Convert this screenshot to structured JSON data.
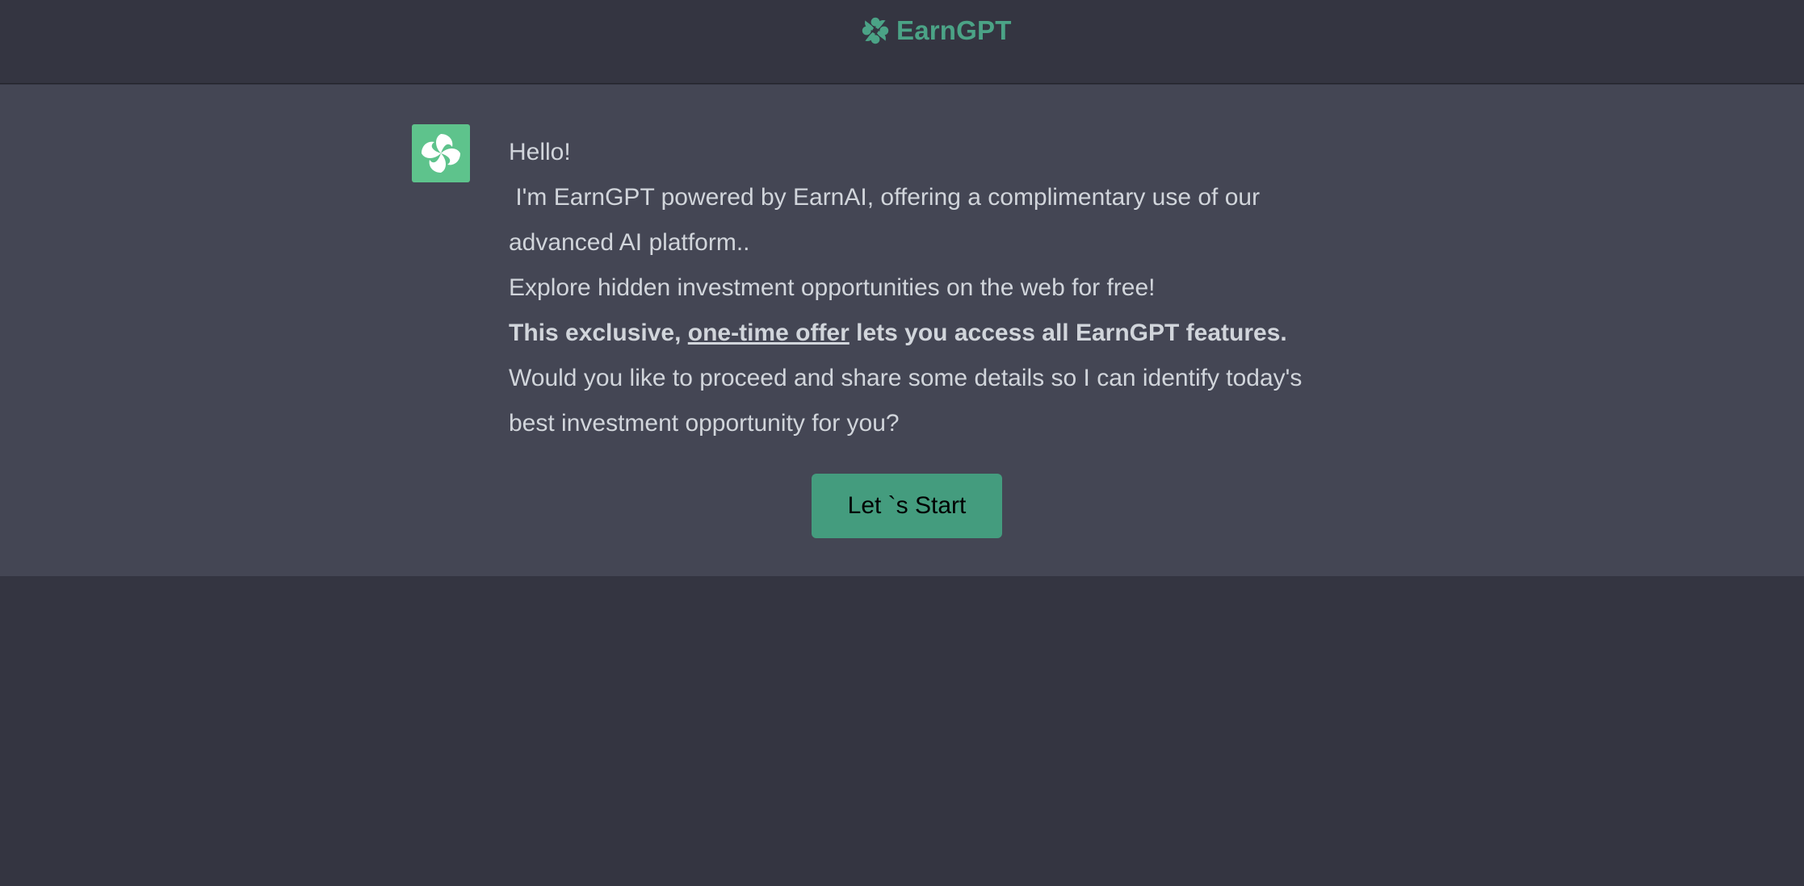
{
  "header": {
    "brand_name": "EarnGPT",
    "brand_icon": "swirl-logo-icon"
  },
  "message": {
    "avatar_icon": "swirl-logo-icon",
    "greeting": "Hello!",
    "intro": "I'm EarnGPT powered by EarnAI, offering a complimentary use of our advanced AI platform..",
    "explore": "Explore hidden investment opportunities on the web for free!",
    "offer_prefix": "This exclusive, ",
    "offer_link": "one-time offer",
    "offer_suffix": " lets you access all EarnGPT features.",
    "question": "Would you like to proceed and share some details so I can identify today's best investment opportunity for you?"
  },
  "cta": {
    "start_label": "Let `s Start"
  },
  "colors": {
    "page_background": "#343541",
    "message_background": "#444654",
    "brand_green": "#4ba386",
    "avatar_green": "#5ec38c",
    "button_green": "#449c7e",
    "text": "#d1d5db"
  }
}
